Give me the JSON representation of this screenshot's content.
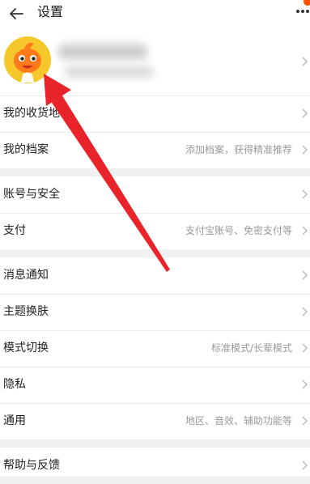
{
  "header": {
    "title": "设置",
    "back_icon": "arrow-left-icon",
    "more_icon": "more-dots-icon",
    "accent": "#ff5000"
  },
  "profile": {
    "avatar_icon": "mascot-avatar",
    "name": "",
    "account": ""
  },
  "rows": [
    {
      "label": "我的收货地址",
      "value": ""
    },
    {
      "label": "我的档案",
      "value": "添加档案，获得精准推荐"
    },
    {
      "label": "账号与安全",
      "value": ""
    },
    {
      "label": "支付",
      "value": "支付宝账号、免密支付等"
    },
    {
      "label": "消息通知",
      "value": ""
    },
    {
      "label": "主题换肤",
      "value": ""
    },
    {
      "label": "模式切换",
      "value": "标准模式/长辈模式"
    },
    {
      "label": "隐私",
      "value": ""
    },
    {
      "label": "通用",
      "value": "地区、音效、辅助功能等"
    },
    {
      "label": "帮助与反馈",
      "value": ""
    }
  ],
  "annotation": {
    "color": "#e8232a"
  }
}
